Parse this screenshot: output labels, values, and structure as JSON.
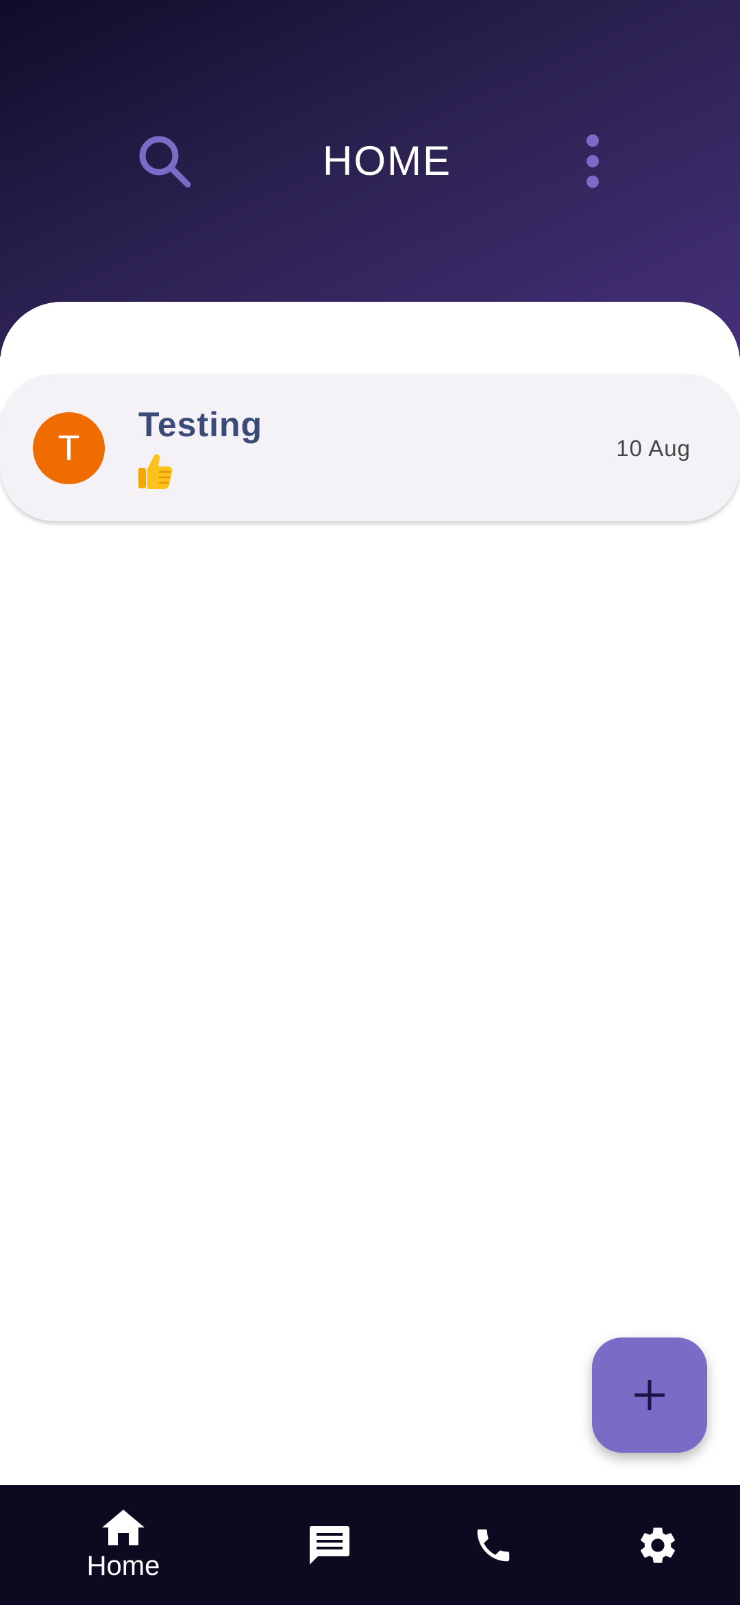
{
  "header": {
    "title": "HOME",
    "search_icon": "search-icon",
    "more_icon": "more-vertical-icon"
  },
  "chats": [
    {
      "avatar_letter": "T",
      "avatar_color": "#ef6c00",
      "name": "Testing",
      "preview_icon": "thumbs-up-emoji",
      "time": "10 Aug"
    }
  ],
  "fab": {
    "icon": "plus-icon",
    "color": "#7b6ac6"
  },
  "bottom_nav": {
    "items": [
      {
        "label": "Home",
        "icon": "home-icon",
        "active": true
      },
      {
        "label": "",
        "icon": "chat-icon",
        "active": false
      },
      {
        "label": "",
        "icon": "phone-icon",
        "active": false
      },
      {
        "label": "",
        "icon": "gear-icon",
        "active": false
      }
    ]
  },
  "colors": {
    "header_gradient_start": "#0f0c29",
    "header_gradient_end": "#46307a",
    "accent": "#7b6ac6",
    "chat_name": "#3c4a78",
    "nav_background": "#0b0a20"
  }
}
